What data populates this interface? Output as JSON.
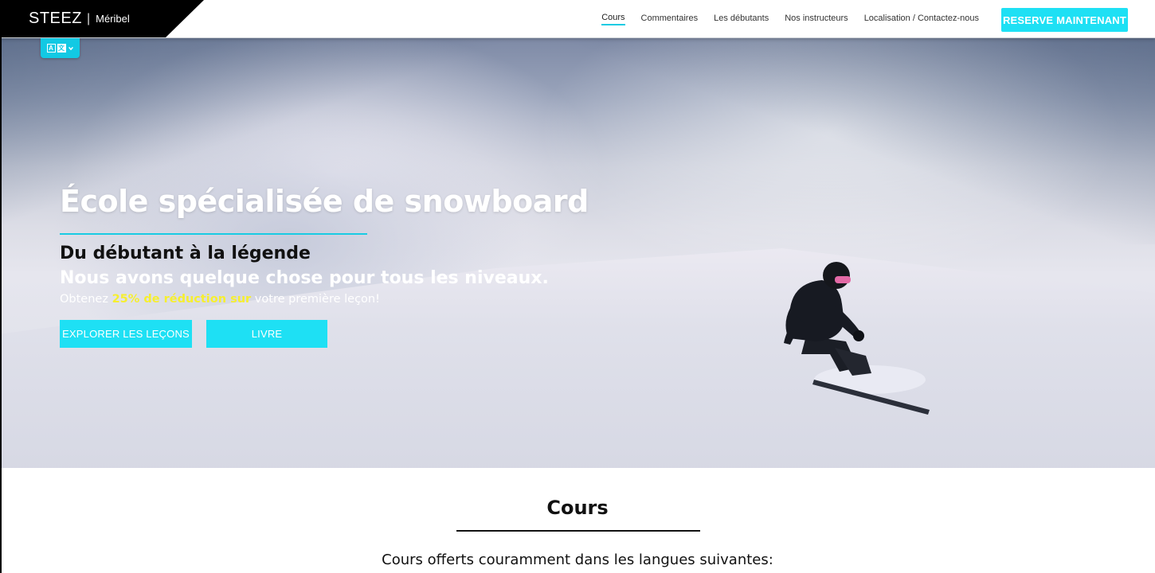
{
  "header": {
    "brand": "STEEZ",
    "separator": "|",
    "location": "Méribel",
    "nav": [
      {
        "label": "Cours",
        "active": true
      },
      {
        "label": "Commentaires",
        "active": false
      },
      {
        "label": "Les débutants",
        "active": false
      },
      {
        "label": "Nos instructeurs",
        "active": false
      },
      {
        "label": "Localisation / Contactez-nous",
        "active": false
      }
    ],
    "cta": "RESERVE MAINTENANT"
  },
  "language_switcher": {
    "icon": "translate-icon",
    "chevron": "chevron-down-icon"
  },
  "hero": {
    "title": "École spécialisée de snowboard",
    "subtitle_dark": "Du débutant à la légende",
    "subtitle_light": "Nous avons quelque chose pour tous les niveaux.",
    "promo_prefix": "Obtenez ",
    "promo_highlight": "25% de réduction sur",
    "promo_suffix": " votre première leçon!",
    "buttons": {
      "explore": "EXPLORER LES LEÇONS",
      "book": "LIVRE"
    },
    "image": "snowboarder-in-powder"
  },
  "courses": {
    "title": "Cours",
    "subtitle": "Cours offerts couramment dans les langues suivantes:"
  },
  "colors": {
    "accent": "#1ee0f4",
    "highlight": "#f6ef2f",
    "logo_bg": "#000000"
  }
}
